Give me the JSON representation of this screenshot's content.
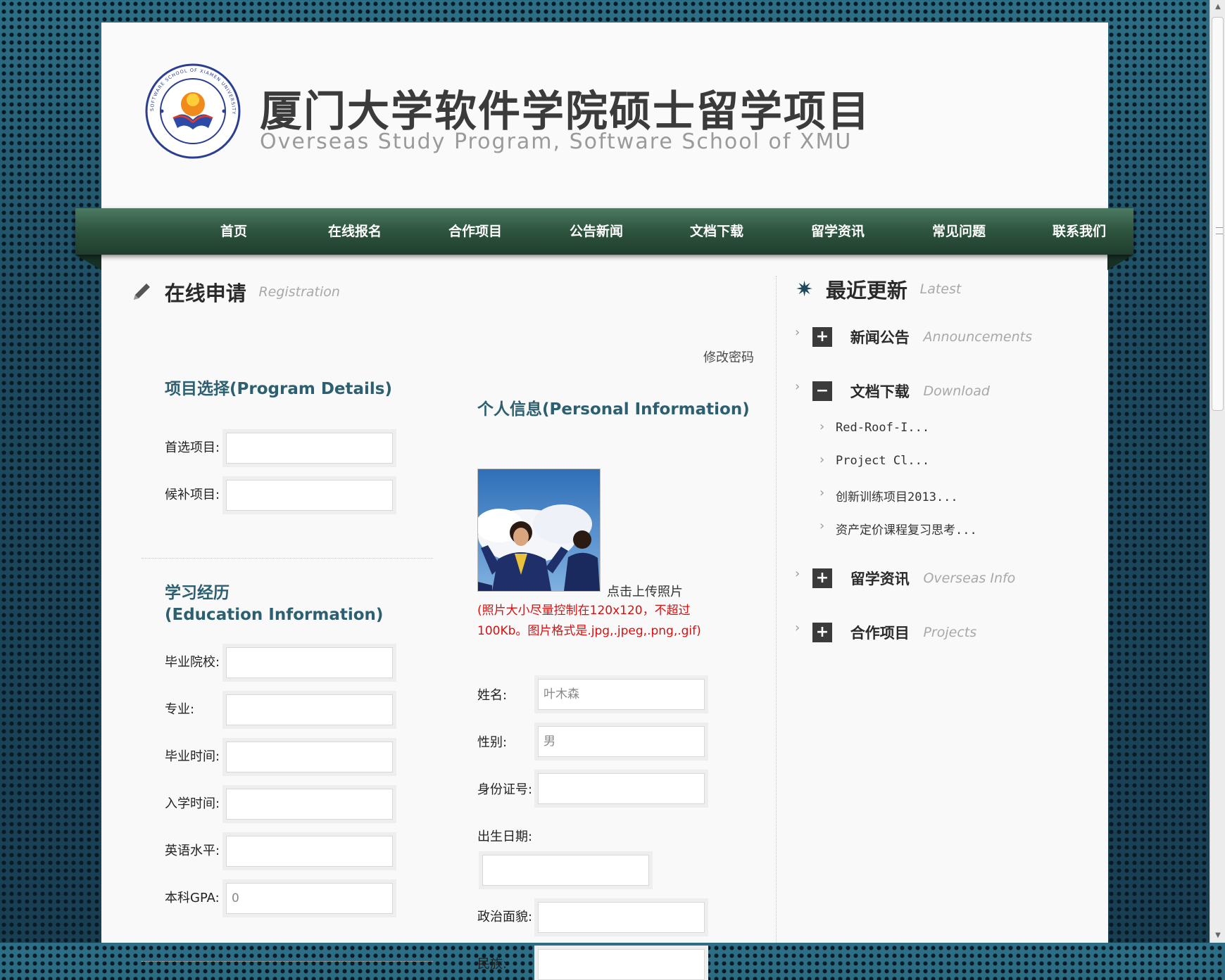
{
  "header": {
    "title": "厦门大学软件学院硕士留学项目",
    "subtitle": "Overseas Study Program,  Software School of XMU",
    "logo_ring_text": "SOFTWARE SCHOOL OF XIAMEN UNIVERSITY"
  },
  "nav": {
    "items": [
      {
        "label": "首页"
      },
      {
        "label": "在线报名"
      },
      {
        "label": "合作项目"
      },
      {
        "label": "公告新闻"
      },
      {
        "label": "文档下载"
      },
      {
        "label": "留学资讯"
      },
      {
        "label": "常见问题"
      },
      {
        "label": "联系我们"
      }
    ]
  },
  "registration": {
    "title": "在线申请",
    "title_en": "Registration",
    "change_password": "修改密码",
    "program": {
      "title": "项目选择(Program Details)",
      "first_label": "首选项目:",
      "first_value": "",
      "alt_label": "候补项目:",
      "alt_value": ""
    },
    "education": {
      "title_line1": "学习经历",
      "title_line2": "(Education Information)",
      "school_label": "毕业院校:",
      "school_value": "",
      "major_label": "专业:",
      "major_value": "",
      "grad_label": "毕业时间:",
      "grad_value": "",
      "enroll_label": "入学时间:",
      "enroll_value": "",
      "english_label": "英语水平:",
      "english_value": "",
      "gpa_label": "本科GPA:",
      "gpa_value": "0"
    },
    "personal": {
      "title": "个人信息(Personal Information)",
      "upload_link": "点击上传照片",
      "photo_note": "(照片大小尽量控制在120x120，不超过100Kb。图片格式是.jpg,.jpeg,.png,.gif)",
      "name_label": "姓名:",
      "name_value": "叶木森",
      "gender_label": "性别:",
      "gender_value": "男",
      "id_label": "身份证号:",
      "id_value": "",
      "birth_label": "出生日期:",
      "birth_value": "",
      "political_label": "政治面貌:",
      "political_value": "",
      "ethnicity_label": "民族:",
      "ethnicity_value": ""
    }
  },
  "sidebar": {
    "title": "最近更新",
    "title_en": "Latest",
    "sections": [
      {
        "label": "新闻公告",
        "label_en": "Announcements",
        "toggle": "+"
      },
      {
        "label": "文档下载",
        "label_en": "Download",
        "toggle": "−"
      },
      {
        "label": "留学资讯",
        "label_en": "Overseas Info",
        "toggle": "+"
      },
      {
        "label": "合作项目",
        "label_en": "Projects",
        "toggle": "+"
      }
    ],
    "downloads": [
      {
        "label": "Red-Roof-I..."
      },
      {
        "label": "Project Cl..."
      },
      {
        "label": "创新训练项目2013..."
      },
      {
        "label": "资产定价课程复习思考..."
      }
    ]
  },
  "colors": {
    "nav_green": "#2f5640",
    "section_title": "#2c5f6f",
    "note_red": "#d91010",
    "background_blue": "#1f4a5e"
  }
}
